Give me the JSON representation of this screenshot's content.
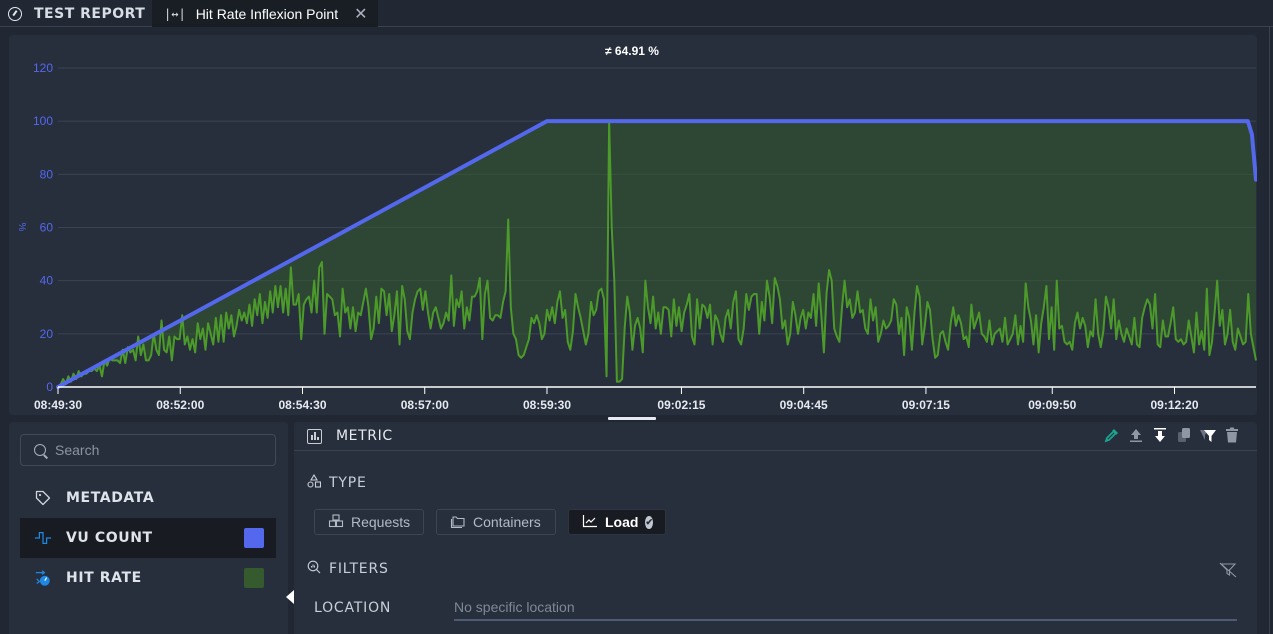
{
  "header": {
    "app_title": "TEST REPORT",
    "app_icon": "gauge-icon",
    "tab": {
      "icon": "fit-width-icon",
      "icon_text": "|↔|",
      "label": "Hit Rate Inflexion Point",
      "close_icon": "close-icon",
      "close_text": "✕"
    }
  },
  "chart_data": {
    "type": "line",
    "title": "≠ 64.91 %",
    "xlabel": "",
    "ylabel": "%",
    "ylim": [
      0,
      120
    ],
    "yticks": [
      "0",
      "20",
      "40",
      "60",
      "80",
      "100",
      "120"
    ],
    "xticks": [
      "08:49:30",
      "08:52:00",
      "08:54:30",
      "08:57:00",
      "08:59:30",
      "09:02:15",
      "09:04:45",
      "09:07:15",
      "09:09:50",
      "09:12:20"
    ],
    "xtick_seconds": [
      0,
      150,
      300,
      450,
      600,
      765,
      915,
      1065,
      1220,
      1370
    ],
    "x_range_seconds": [
      0,
      1470
    ],
    "grid": true,
    "fill_between_series": true,
    "series": [
      {
        "name": "VU COUNT",
        "color": "#5468ee",
        "x_seconds": [
          0,
          600,
          610,
          1460,
          1465,
          1470
        ],
        "values": [
          0,
          100,
          100,
          100,
          95,
          78
        ]
      },
      {
        "name": "HIT RATE",
        "color": "#4c9a2a",
        "sample_interval_seconds": 5,
        "values": [
          0,
          1,
          3,
          1,
          4,
          2,
          5,
          3,
          6,
          4,
          5,
          5,
          6,
          6,
          7,
          6,
          8,
          4,
          10,
          8,
          11,
          10,
          10,
          10,
          9,
          14,
          9,
          15,
          13,
          14,
          10,
          19,
          12,
          16,
          10,
          10,
          12,
          20,
          14,
          12,
          25,
          14,
          13,
          19,
          10,
          19,
          18,
          18,
          27,
          16,
          19,
          14,
          18,
          13,
          24,
          18,
          22,
          14,
          24,
          20,
          16,
          26,
          17,
          27,
          17,
          28,
          22,
          27,
          19,
          23,
          29,
          25,
          28,
          24,
          31,
          23,
          33,
          27,
          35,
          24,
          32,
          26,
          36,
          28,
          38,
          30,
          38,
          28,
          37,
          27,
          45,
          31,
          31,
          35,
          18,
          31,
          33,
          34,
          28,
          40,
          28,
          45,
          47,
          20,
          35,
          34,
          33,
          27,
          28,
          19,
          37,
          28,
          30,
          22,
          30,
          21,
          28,
          27,
          32,
          37,
          30,
          18,
          22,
          34,
          24,
          37,
          36,
          27,
          35,
          21,
          27,
          36,
          16,
          38,
          33,
          21,
          18,
          28,
          33,
          36,
          37,
          29,
          36,
          28,
          22,
          28,
          30,
          26,
          22,
          24,
          28,
          25,
          42,
          23,
          33,
          30,
          36,
          22,
          30,
          25,
          34,
          34,
          36,
          41,
          18,
          35,
          40,
          26,
          25,
          27,
          27,
          26,
          32,
          36,
          63,
          30,
          20,
          18,
          12,
          11,
          12,
          15,
          18,
          26,
          24,
          27,
          24,
          18,
          20,
          29,
          25,
          30,
          24,
          32,
          36,
          26,
          29,
          17,
          14,
          21,
          35,
          30,
          26,
          21,
          16,
          20,
          32,
          27,
          29,
          36,
          37,
          33,
          4,
          100,
          60,
          40,
          2,
          2,
          3,
          22,
          34,
          28,
          14,
          23,
          26,
          22,
          13,
          40,
          30,
          24,
          34,
          22,
          28,
          20,
          30,
          30,
          29,
          19,
          33,
          23,
          30,
          21,
          28,
          31,
          35,
          19,
          16,
          33,
          22,
          31,
          30,
          26,
          31,
          16,
          27,
          25,
          20,
          17,
          26,
          29,
          22,
          32,
          36,
          18,
          16,
          22,
          35,
          29,
          34,
          35,
          35,
          20,
          32,
          25,
          40,
          34,
          24,
          41,
          38,
          33,
          22,
          25,
          16,
          20,
          32,
          27,
          20,
          26,
          29,
          22,
          28,
          26,
          35,
          23,
          39,
          27,
          13,
          35,
          44,
          40,
          22,
          19,
          17,
          30,
          40,
          30,
          33,
          26,
          28,
          36,
          28,
          29,
          22,
          20,
          33,
          25,
          30,
          17,
          20,
          25,
          22,
          23,
          25,
          33,
          31,
          20,
          26,
          12,
          30,
          26,
          14,
          28,
          38,
          34,
          16,
          23,
          32,
          29,
          18,
          11,
          12,
          20,
          21,
          17,
          14,
          24,
          30,
          23,
          27,
          24,
          18,
          19,
          15,
          31,
          22,
          25,
          28,
          20,
          19,
          17,
          25,
          16,
          20,
          21,
          22,
          17,
          26,
          16,
          18,
          20,
          27,
          16,
          23,
          17,
          39,
          30,
          25,
          16,
          27,
          13,
          24,
          30,
          38,
          18,
          30,
          14,
          40,
          22,
          23,
          17,
          16,
          17,
          14,
          24,
          28,
          22,
          26,
          23,
          15,
          21,
          19,
          33,
          20,
          15,
          21,
          34,
          30,
          22,
          33,
          18,
          25,
          20,
          17,
          22,
          19,
          16,
          26,
          16,
          15,
          26,
          30,
          33,
          31,
          22,
          35,
          16,
          15,
          25,
          19,
          19,
          24,
          30,
          18,
          17,
          18,
          16,
          17,
          25,
          19,
          13,
          28,
          16,
          21,
          14,
          37,
          12,
          17,
          28,
          40,
          23,
          29,
          16,
          20,
          29,
          17,
          14,
          22,
          19,
          16,
          17,
          35,
          20,
          15,
          10
        ]
      }
    ]
  },
  "sidebar": {
    "search_placeholder": "Search",
    "search_value": "",
    "items": [
      {
        "label": "METADATA",
        "icon": "tag-icon"
      },
      {
        "label": "VU COUNT",
        "icon": "pulse-wave-icon",
        "color": "#5468ee",
        "selected": true
      },
      {
        "label": "HIT RATE",
        "icon": "speedometer-icon",
        "color": "#355a2e",
        "selected": false
      }
    ]
  },
  "metric_panel": {
    "title": "METRIC",
    "toolbar": [
      {
        "name": "color-picker-icon",
        "label": "Color picker"
      },
      {
        "name": "upload-icon",
        "label": "Move up"
      },
      {
        "name": "download-icon",
        "label": "Move down"
      },
      {
        "name": "copy-icon",
        "label": "Duplicate"
      },
      {
        "name": "filter-icon",
        "label": "Filter"
      },
      {
        "name": "trash-icon",
        "label": "Delete"
      }
    ],
    "type_label": "TYPE",
    "types": [
      {
        "label": "Requests",
        "icon": "cubes-icon",
        "active": false
      },
      {
        "label": "Containers",
        "icon": "folder-icon",
        "active": false
      },
      {
        "label": "Load",
        "icon": "line-chart-icon",
        "active": true
      }
    ],
    "filters_label": "FILTERS",
    "location_label": "LOCATION",
    "location_placeholder": "No specific location",
    "location_value": ""
  }
}
